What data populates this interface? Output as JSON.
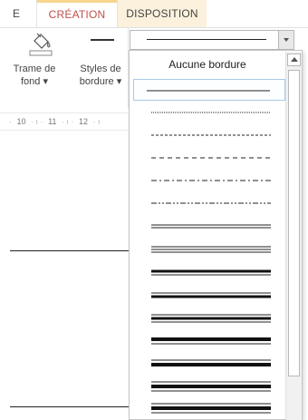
{
  "tabs": {
    "partial_tab": "E",
    "creation": "CRÉATION",
    "disposition": "DISPOSITION"
  },
  "ribbon": {
    "shading_button": {
      "line1": "Trame de",
      "line2": "fond ▾",
      "icon": "paint-bucket-icon"
    },
    "border_styles_button": {
      "line1": "Styles de",
      "line2": "bordure ▾",
      "icon": "line-style-icon"
    },
    "border_select": {
      "icon": "chevron-down-icon"
    }
  },
  "ruler": {
    "labels": [
      "10",
      "11",
      "12"
    ]
  },
  "border_dropdown": {
    "none_label": "Aucune bordure",
    "selected_index": 0,
    "styles": [
      "single",
      "dotted",
      "dashed-small",
      "dashed",
      "dash-dot",
      "dash-dot-dot",
      "double",
      "triple",
      "thick-thin-small",
      "thin-thick-small",
      "thin-thick-thin-small",
      "thick-thin-medium",
      "thin-thick-medium",
      "thin-thick-thin-medium"
    ]
  },
  "colors": {
    "accent": "#c0504d",
    "tab_highlight": "#f6d58c",
    "selection_border": "#a8c8e8"
  }
}
